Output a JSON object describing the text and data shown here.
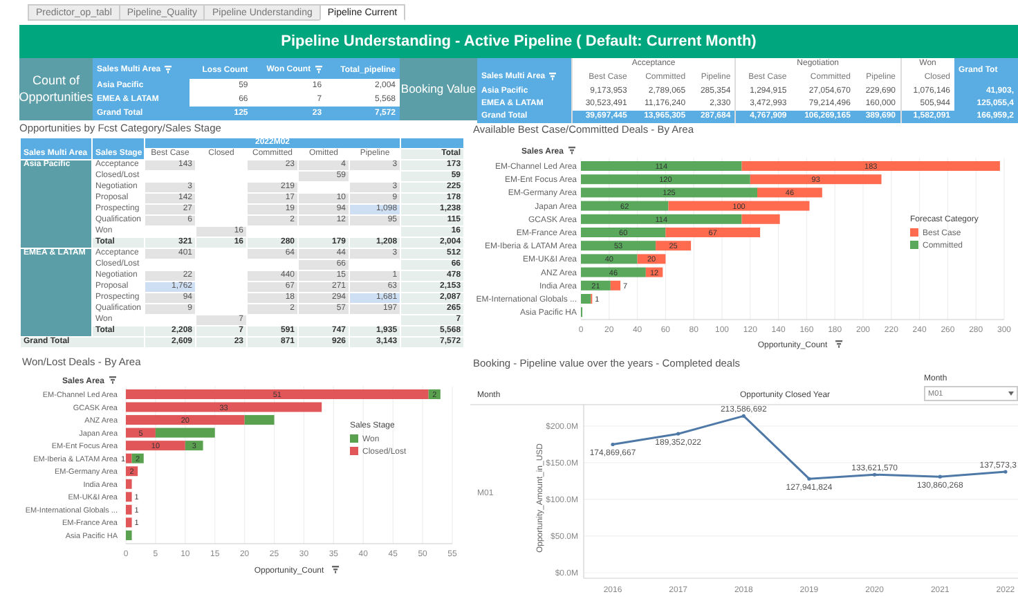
{
  "tabs": [
    {
      "label": "Predictor_op_tabl",
      "selected": false
    },
    {
      "label": "Pipeline_Quality",
      "selected": false
    },
    {
      "label": "Pipeline Understanding",
      "selected": false
    },
    {
      "label": "Pipeline Current",
      "selected": true
    }
  ],
  "header": {
    "title": "Pipeline Understanding - Active Pipeline ( Default: Current Month)"
  },
  "count_block": {
    "label": "Count of Opportunities",
    "columns": [
      {
        "label": "Sales Multi Area",
        "filter": true
      },
      {
        "label": "Loss Count",
        "filter": false
      },
      {
        "label": "Won Count",
        "filter": true
      },
      {
        "label": "Total_pipeline",
        "filter": false
      }
    ],
    "rows": [
      {
        "kind": "area",
        "cells": [
          "Asia Pacific",
          "59",
          "16",
          "2,004"
        ]
      },
      {
        "kind": "area",
        "cells": [
          "EMEA & LATAM",
          "66",
          "7",
          "5,568"
        ]
      },
      {
        "kind": "total",
        "cells": [
          "Grand Total",
          "125",
          "23",
          "7,572"
        ]
      }
    ]
  },
  "booking_block": {
    "label": "Booking Value",
    "row_header": {
      "label": "Sales Multi Area",
      "filter": true
    },
    "groups": [
      {
        "label": "Acceptance",
        "columns": [
          "Best Case",
          "Committed",
          "Pipeline"
        ]
      },
      {
        "label": "Negotiation",
        "columns": [
          "Best Case",
          "Committed",
          "Pipeline"
        ]
      },
      {
        "label": "Won",
        "columns": [
          "Closed"
        ]
      }
    ],
    "total_header": "Grand Tot",
    "rows": [
      {
        "kind": "area",
        "label": "Asia Pacific",
        "cells": [
          "9,173,953",
          "2,789,065",
          "285,354",
          "1,294,915",
          "27,054,670",
          "229,690",
          "1,076,146"
        ],
        "total": "41,903,"
      },
      {
        "kind": "area",
        "label": "EMEA & LATAM",
        "cells": [
          "30,523,491",
          "11,176,240",
          "2,330",
          "3,472,993",
          "79,214,496",
          "160,000",
          "505,944"
        ],
        "total": "125,055,4"
      },
      {
        "kind": "total",
        "label": "Grand Total",
        "cells": [
          "39,697,445",
          "13,965,305",
          "287,684",
          "4,767,909",
          "106,269,165",
          "389,690",
          "1,582,091"
        ],
        "total": "166,959,2"
      }
    ]
  },
  "stage_table": {
    "title": "Opportunities by Fcst Category/Sales Stage",
    "period": "2022M02",
    "columns": [
      "Sales Multi Area",
      "Sales Stage",
      "Best Case",
      "Closed",
      "Committed",
      "Omitted",
      "Pipeline",
      "Total"
    ],
    "areas": [
      {
        "name": "Asia Pacific",
        "rows": [
          {
            "kind": "stage",
            "stage": "Acceptance",
            "cells": [
              "143",
              "",
              "23",
              "4",
              "3"
            ],
            "highlighted": [
              false,
              false,
              false,
              false,
              false
            ],
            "total": "173"
          },
          {
            "kind": "stage",
            "stage": "Closed/Lost",
            "cells": [
              "",
              "",
              "",
              "59",
              ""
            ],
            "highlighted": [
              false,
              false,
              false,
              false,
              false
            ],
            "total": "59"
          },
          {
            "kind": "stage",
            "stage": "Negotiation",
            "cells": [
              "3",
              "",
              "219",
              "",
              "3"
            ],
            "highlighted": [
              false,
              false,
              false,
              false,
              false
            ],
            "total": "225"
          },
          {
            "kind": "stage",
            "stage": "Proposal",
            "cells": [
              "142",
              "",
              "17",
              "10",
              "9"
            ],
            "highlighted": [
              false,
              false,
              false,
              false,
              false
            ],
            "total": "178"
          },
          {
            "kind": "stage",
            "stage": "Prospecting",
            "cells": [
              "27",
              "",
              "19",
              "94",
              "1,098"
            ],
            "highlighted": [
              false,
              false,
              false,
              false,
              true
            ],
            "total": "1,238"
          },
          {
            "kind": "stage",
            "stage": "Qualification",
            "cells": [
              "6",
              "",
              "2",
              "12",
              "95"
            ],
            "highlighted": [
              false,
              false,
              false,
              false,
              false
            ],
            "total": "115"
          },
          {
            "kind": "stage",
            "stage": "Won",
            "cells": [
              "",
              "16",
              "",
              "",
              ""
            ],
            "highlighted": [
              false,
              false,
              false,
              false,
              false
            ],
            "total": "16"
          },
          {
            "kind": "total",
            "stage": "Total",
            "cells": [
              "321",
              "16",
              "280",
              "179",
              "1,208"
            ],
            "highlighted": [
              false,
              false,
              false,
              false,
              false
            ],
            "total": "2,004"
          }
        ]
      },
      {
        "name": "EMEA & LATAM",
        "rows": [
          {
            "kind": "stage",
            "stage": "Acceptance",
            "cells": [
              "401",
              "",
              "64",
              "44",
              "3"
            ],
            "highlighted": [
              false,
              false,
              false,
              false,
              false
            ],
            "total": "512"
          },
          {
            "kind": "stage",
            "stage": "Closed/Lost",
            "cells": [
              "",
              "",
              "",
              "66",
              ""
            ],
            "highlighted": [
              false,
              false,
              false,
              false,
              false
            ],
            "total": "66"
          },
          {
            "kind": "stage",
            "stage": "Negotiation",
            "cells": [
              "22",
              "",
              "440",
              "15",
              "1"
            ],
            "highlighted": [
              false,
              false,
              false,
              false,
              false
            ],
            "total": "478"
          },
          {
            "kind": "stage",
            "stage": "Proposal",
            "cells": [
              "1,762",
              "",
              "67",
              "271",
              "63"
            ],
            "highlighted": [
              true,
              false,
              false,
              false,
              false
            ],
            "total": "2,153"
          },
          {
            "kind": "stage",
            "stage": "Prospecting",
            "cells": [
              "94",
              "",
              "18",
              "294",
              "1,681"
            ],
            "highlighted": [
              false,
              false,
              false,
              false,
              true
            ],
            "total": "2,087"
          },
          {
            "kind": "stage",
            "stage": "Qualification",
            "cells": [
              "9",
              "",
              "2",
              "57",
              "197"
            ],
            "highlighted": [
              false,
              false,
              false,
              false,
              false
            ],
            "total": "265"
          },
          {
            "kind": "stage",
            "stage": "Won",
            "cells": [
              "",
              "7",
              "",
              "",
              ""
            ],
            "highlighted": [
              false,
              false,
              false,
              false,
              false
            ],
            "total": "7"
          },
          {
            "kind": "total",
            "stage": "Total",
            "cells": [
              "2,208",
              "7",
              "591",
              "747",
              "1,935"
            ],
            "highlighted": [
              false,
              false,
              false,
              false,
              false
            ],
            "total": "5,568"
          }
        ]
      }
    ],
    "grand_total": {
      "label": "Grand Total",
      "cells": [
        "2,609",
        "23",
        "871",
        "926",
        "3,143"
      ],
      "total": "7,572"
    }
  },
  "forecast_panel": {
    "legend_title": "Forecast Category",
    "chart_data": {
      "type": "bar",
      "orientation": "horizontal",
      "stacked": true,
      "title": "Available Best Case/Committed Deals - By Area",
      "xlabel": "Opportunity_Count",
      "ylabel": "Sales Area",
      "categories": [
        "EM-Channel Led Area",
        "EM-Ent Focus Area",
        "EM-Germany Area",
        "Japan Area",
        "GCASK Area",
        "EM-France Area",
        "EM-Iberia & LATAM Area",
        "EM-UK&I Area",
        "ANZ Area",
        "India Area",
        "EM-International Globals ...",
        "Asia Pacific HA"
      ],
      "series": [
        {
          "name": "Committed",
          "color": "#59a85b",
          "values": [
            114,
            120,
            125,
            62,
            114,
            60,
            53,
            40,
            46,
            21,
            7,
            1
          ]
        },
        {
          "name": "Best Case",
          "color": "#ff6b4f",
          "values": [
            183,
            93,
            46,
            100,
            27,
            67,
            25,
            20,
            12,
            7,
            1,
            0
          ]
        }
      ],
      "xlim": [
        0,
        300
      ],
      "grid": true,
      "legend": "right",
      "xticks": [
        0,
        20,
        40,
        60,
        80,
        100,
        120,
        140,
        160,
        180,
        200,
        220,
        240,
        260,
        280,
        300
      ],
      "value_labels": [
        [
          "114",
          "120",
          "125",
          "62",
          "114",
          "60",
          "53",
          "40",
          "46",
          "21",
          null,
          null
        ],
        [
          "183",
          "93",
          "46",
          "100",
          null,
          "67",
          "25",
          "20",
          "12",
          "7",
          "1",
          null
        ]
      ]
    }
  },
  "wonlost_panel": {
    "legend_title": "Sales Stage",
    "chart_data": {
      "type": "bar",
      "orientation": "horizontal",
      "stacked": true,
      "title": "Won/Lost Deals - By Area",
      "xlabel": "Opportunity_Count",
      "ylabel": "Sales Area",
      "categories": [
        "EM-Channel Led Area",
        "GCASK Area",
        "ANZ Area",
        "Japan Area",
        "EM-Ent Focus Area",
        "EM-Iberia & LATAM Area",
        "EM-Germany Area",
        "India Area",
        "EM-UK&I Area",
        "EM-International Globals ...",
        "EM-France Area",
        "Asia Pacific HA"
      ],
      "series": [
        {
          "name": "Closed/Lost",
          "color": "#e15759",
          "values": [
            51,
            33,
            20,
            5,
            10,
            1,
            2,
            1,
            1,
            1,
            1,
            0
          ]
        },
        {
          "name": "Won",
          "color": "#59a14f",
          "values": [
            2,
            0,
            5,
            10,
            3,
            2,
            0,
            0,
            0,
            0,
            0,
            1
          ]
        }
      ],
      "xlim": [
        0,
        55
      ],
      "grid": true,
      "legend": "right",
      "xticks": [
        0,
        5,
        10,
        15,
        20,
        25,
        30,
        35,
        40,
        45,
        50,
        55
      ],
      "value_labels": [
        [
          "51",
          "33",
          "20",
          "5",
          "10",
          "1",
          "2",
          null,
          "1",
          "1",
          "1",
          null
        ],
        [
          "2",
          null,
          null,
          null,
          "3",
          "2",
          null,
          null,
          null,
          null,
          null,
          null
        ]
      ]
    }
  },
  "booking_panel": {
    "row_header": "Month",
    "filter": {
      "label": "Month",
      "value": "M01"
    },
    "chart_data": {
      "type": "line",
      "title": "Booking - Pipeline value over the years - Completed deals",
      "xlabel": "Opportunity Closed Year",
      "ylabel": "Opportunity_Amount_in_USD",
      "x": [
        "2016",
        "2017",
        "2018",
        "2019",
        "2020",
        "2021",
        "2022"
      ],
      "series": [
        {
          "name": "M01",
          "color": "#4e79a7",
          "values": [
            174869667,
            189352022,
            213586692,
            127941824,
            133621570,
            130860268,
            137573300
          ]
        }
      ],
      "ylim": [
        0,
        230000000
      ],
      "grid": true,
      "yticks": [
        {
          "value": 0,
          "label": "$0.0M"
        },
        {
          "value": 50000000,
          "label": "$50.0M"
        },
        {
          "value": 100000000,
          "label": "$100.0M"
        },
        {
          "value": 150000000,
          "label": "$150.0M"
        },
        {
          "value": 200000000,
          "label": "$200.0M"
        }
      ],
      "value_labels": [
        [
          "174,869,667",
          "189,352,022",
          "213,586,692",
          "127,941,824",
          "133,621,570",
          "130,860,268",
          "137,573,3"
        ]
      ]
    }
  }
}
